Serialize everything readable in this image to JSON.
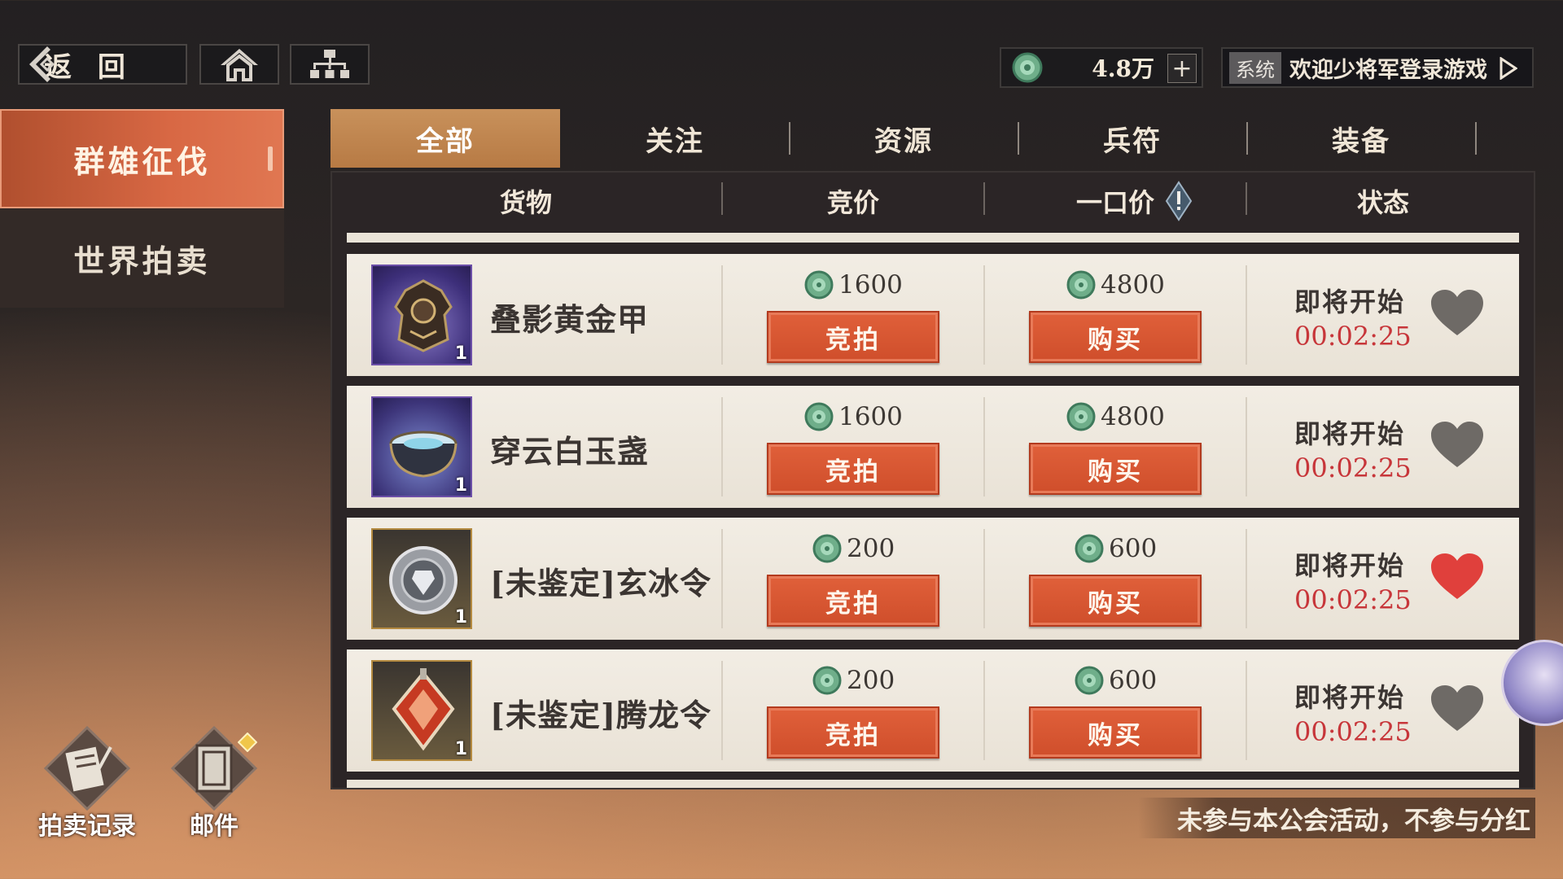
{
  "topbar": {
    "back_label": "返 回",
    "currency_amount": "4.8万",
    "plus_label": "+",
    "system_tag": "系统",
    "system_message": "欢迎少将军登录游戏"
  },
  "left_menu": {
    "items": [
      {
        "label": "群雄征伐",
        "active": true
      },
      {
        "label": "世界拍卖",
        "active": false
      }
    ]
  },
  "tabs": [
    {
      "label": "全部",
      "active": true
    },
    {
      "label": "关注"
    },
    {
      "label": "资源"
    },
    {
      "label": "兵符"
    },
    {
      "label": "装备"
    }
  ],
  "columns": {
    "goods": "货物",
    "bid": "竞价",
    "buyout": "一口价",
    "status": "状态"
  },
  "rows": [
    {
      "name": "叠影黄金甲",
      "qty": "1",
      "bid_price": "1600",
      "buy_price": "4800",
      "bid_label": "竞拍",
      "buy_label": "购买",
      "status": "即将开始",
      "timer": "00:02:25",
      "favorited": false
    },
    {
      "name": "穿云白玉盏",
      "qty": "1",
      "bid_price": "1600",
      "buy_price": "4800",
      "bid_label": "竞拍",
      "buy_label": "购买",
      "status": "即将开始",
      "timer": "00:02:25",
      "favorited": false
    },
    {
      "name": "[未鉴定]玄冰令",
      "qty": "1",
      "bid_price": "200",
      "buy_price": "600",
      "bid_label": "竞拍",
      "buy_label": "购买",
      "status": "即将开始",
      "timer": "00:02:25",
      "favorited": true
    },
    {
      "name": "[未鉴定]腾龙令",
      "qty": "1",
      "bid_price": "200",
      "buy_price": "600",
      "bid_label": "竞拍",
      "buy_label": "购买",
      "status": "即将开始",
      "timer": "00:02:25",
      "favorited": false
    }
  ],
  "bottom": {
    "auction_record_label": "拍卖记录",
    "mail_label": "邮件",
    "notice": "未参与本公会活动，不参与分红"
  },
  "colors": {
    "accent_orange": "#d86844",
    "tab_gold": "#c8915b",
    "button_red": "#cf4e2b",
    "timer_red": "#c7363a",
    "heart_active": "#e0403c",
    "heart_idle": "#6e6a66"
  }
}
